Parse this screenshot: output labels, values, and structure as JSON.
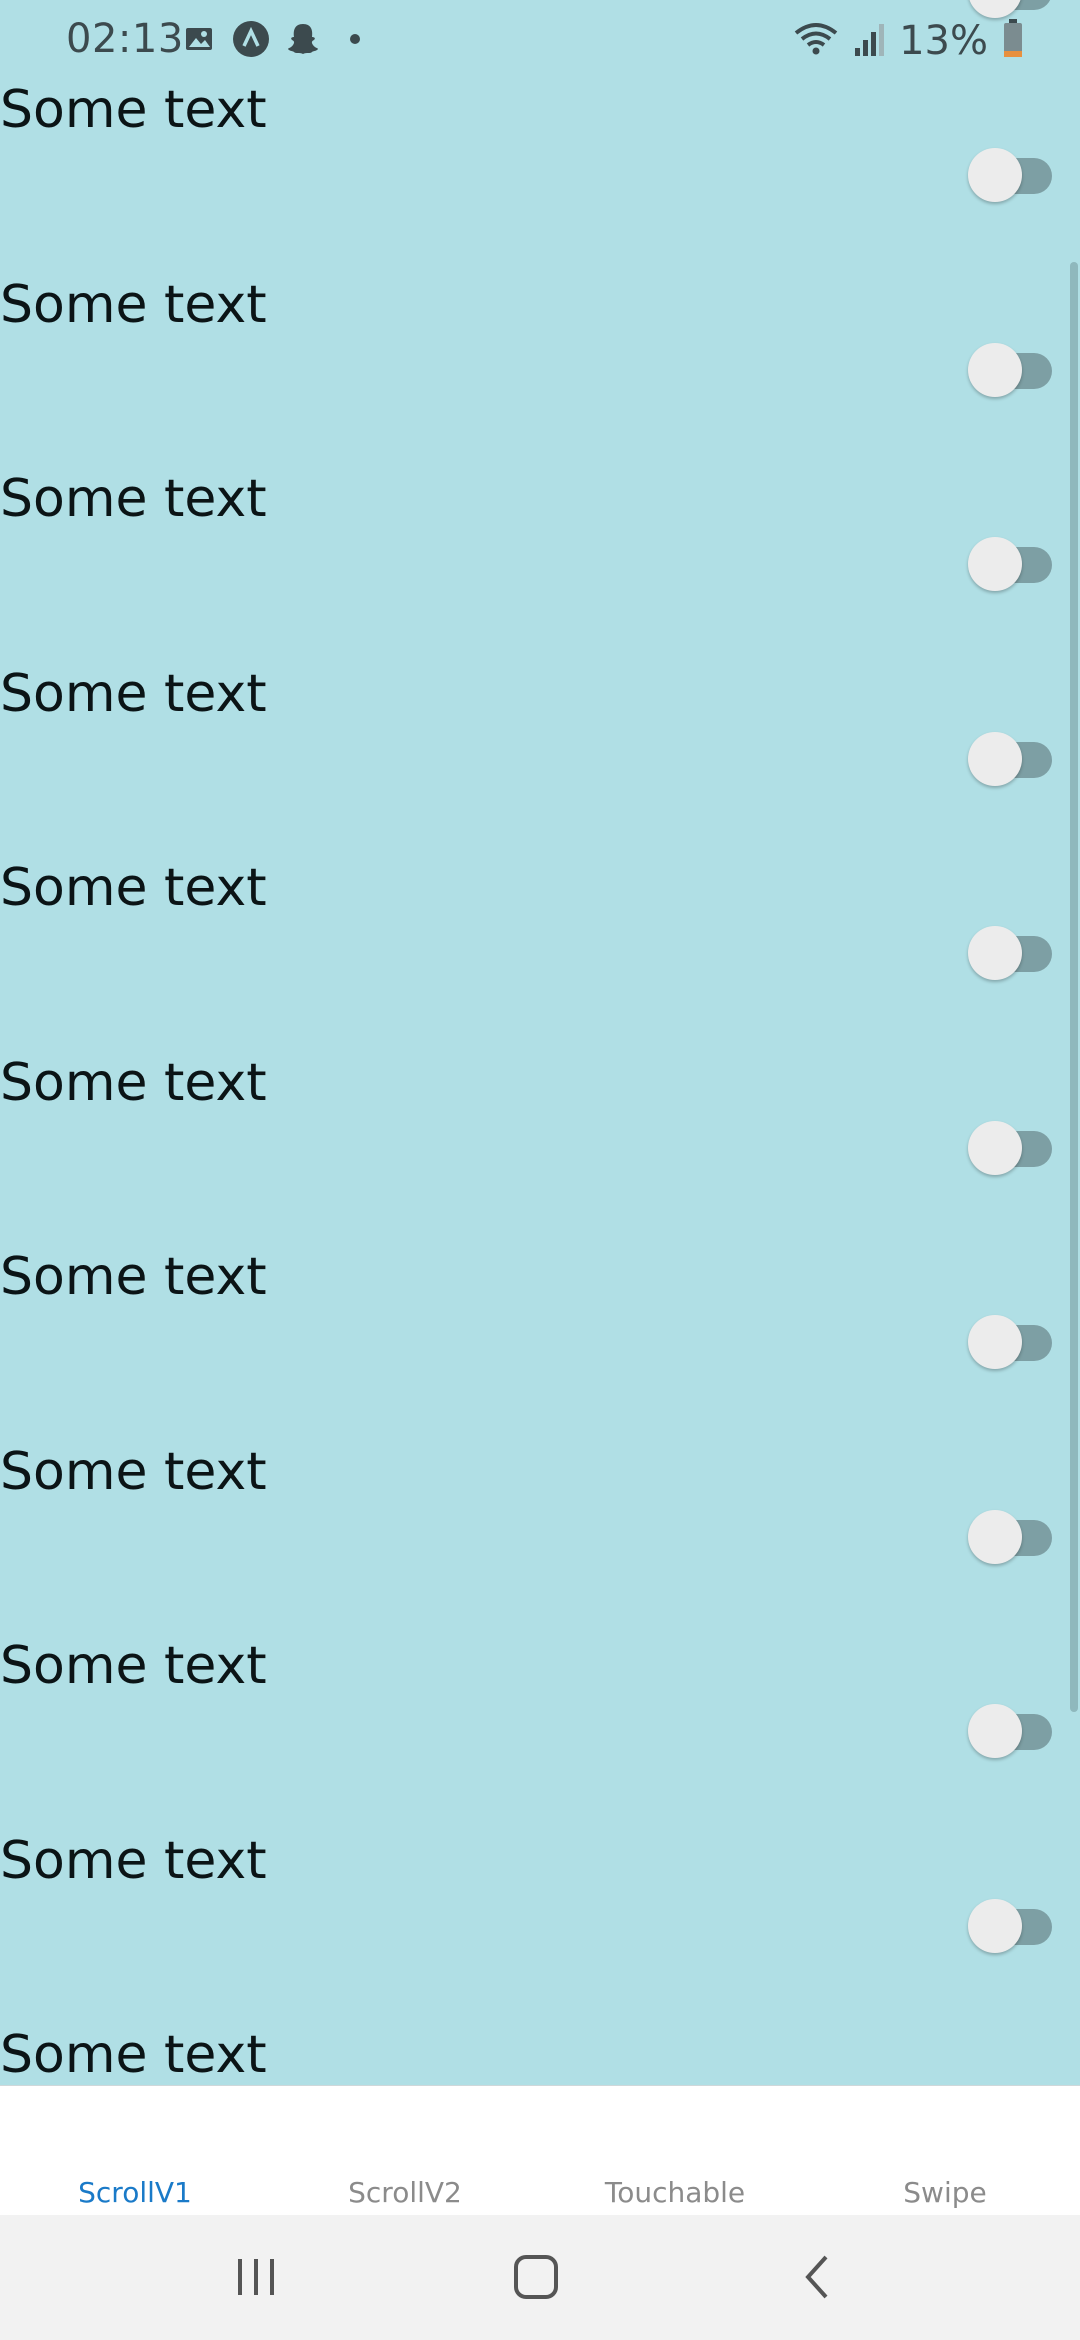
{
  "status": {
    "time": "02:13",
    "battery": "13%",
    "left_icons": [
      "gallery-icon",
      "app-a-icon",
      "snapchat-icon",
      "dot-icon"
    ],
    "right_icons": [
      "wifi-icon",
      "signal-icon",
      "battery-icon"
    ]
  },
  "rows": [
    {
      "label": "Some text",
      "toggle_on": false
    },
    {
      "label": "Some text",
      "toggle_on": false
    },
    {
      "label": "Some text",
      "toggle_on": false
    },
    {
      "label": "Some text",
      "toggle_on": false
    },
    {
      "label": "Some text",
      "toggle_on": false
    },
    {
      "label": "Some text",
      "toggle_on": false
    },
    {
      "label": "Some text",
      "toggle_on": false
    },
    {
      "label": "Some text",
      "toggle_on": false
    },
    {
      "label": "Some text",
      "toggle_on": false
    },
    {
      "label": "Some text",
      "toggle_on": false
    },
    {
      "label": "Some text",
      "toggle_on": false
    }
  ],
  "tabs": [
    {
      "label": "ScrollV1",
      "active": true
    },
    {
      "label": "ScrollV2",
      "active": false
    },
    {
      "label": "Touchable",
      "active": false
    },
    {
      "label": "Swipe",
      "active": false
    }
  ],
  "nav": [
    "recents-icon",
    "home-icon",
    "back-icon"
  ],
  "colors": {
    "background": "#b0dfe5",
    "active_tab": "#1a7ac8",
    "toggle_track": "#7d9fa4",
    "toggle_knob": "#ececec"
  }
}
